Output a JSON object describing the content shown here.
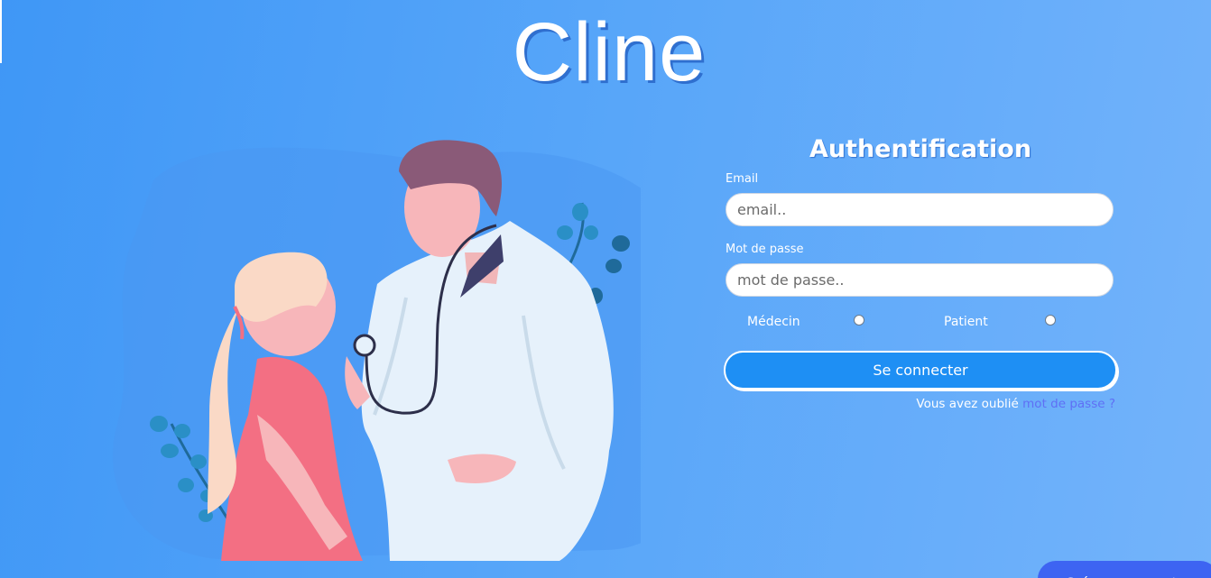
{
  "app": {
    "title": "Cline"
  },
  "auth": {
    "heading": "Authentification",
    "email_label": "Email",
    "email_placeholder": "email..",
    "password_label": "Mot de passe",
    "password_placeholder": "mot de passe..",
    "roles": [
      {
        "label": "Médecin",
        "selected": false
      },
      {
        "label": "Patient",
        "selected": false
      }
    ],
    "submit_label": "Se connecter",
    "forgot_prefix": "Vous avez oublié",
    "forgot_link": "mot de passe ?"
  },
  "footer": {
    "create_account_label": "Créer un compte"
  },
  "colors": {
    "background_start": "#3f97f6",
    "background_end": "#73b3fa",
    "submit_button": "#1e8ff4",
    "create_button": "#3d64f2",
    "link": "#5f6ff5"
  },
  "icons": [
    "doctor-patient-illustration"
  ]
}
